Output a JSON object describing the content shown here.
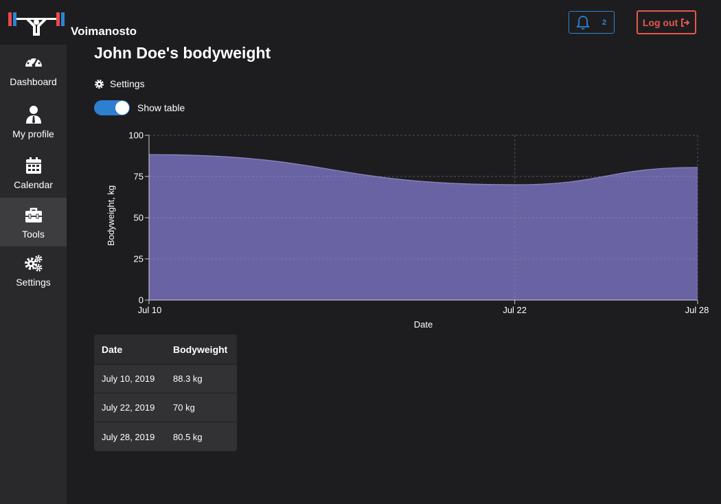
{
  "header": {
    "app_name": "Voimanosto",
    "notification_count": "2",
    "logout_label": "Log out"
  },
  "sidebar": {
    "items": [
      {
        "label": "Dashboard",
        "icon": "tachometer-icon"
      },
      {
        "label": "My profile",
        "icon": "user-tie-icon"
      },
      {
        "label": "Calendar",
        "icon": "calendar-icon"
      },
      {
        "label": "Tools",
        "icon": "toolbox-icon",
        "active": true
      },
      {
        "label": "Settings",
        "icon": "cogs-icon"
      }
    ]
  },
  "main": {
    "title": "John Doe's bodyweight",
    "settings_label": "Settings",
    "show_table_label": "Show table",
    "show_table_on": true
  },
  "chart_data": {
    "type": "area",
    "x": [
      "Jul 10",
      "Jul 22",
      "Jul 28"
    ],
    "x_days": [
      10,
      22,
      28
    ],
    "values": [
      88.3,
      70,
      80.5
    ],
    "xlabel": "Date",
    "ylabel": "Bodyweight, kg",
    "ylim": [
      0,
      100
    ],
    "yticks": [
      0,
      25,
      50,
      75,
      100
    ],
    "grid": true,
    "fill_color": "#6a63a3"
  },
  "table": {
    "headers": [
      "Date",
      "Bodyweight"
    ],
    "rows": [
      [
        "July 10, 2019",
        "88.3 kg"
      ],
      [
        "July 22, 2019",
        "70 kg"
      ],
      [
        "July 28, 2019",
        "80.5 kg"
      ]
    ]
  },
  "colors": {
    "accent_blue": "#2e84d6",
    "logout_red": "#e8574f",
    "logo_red": "#e84a4a",
    "logo_blue": "#2e84d6"
  }
}
